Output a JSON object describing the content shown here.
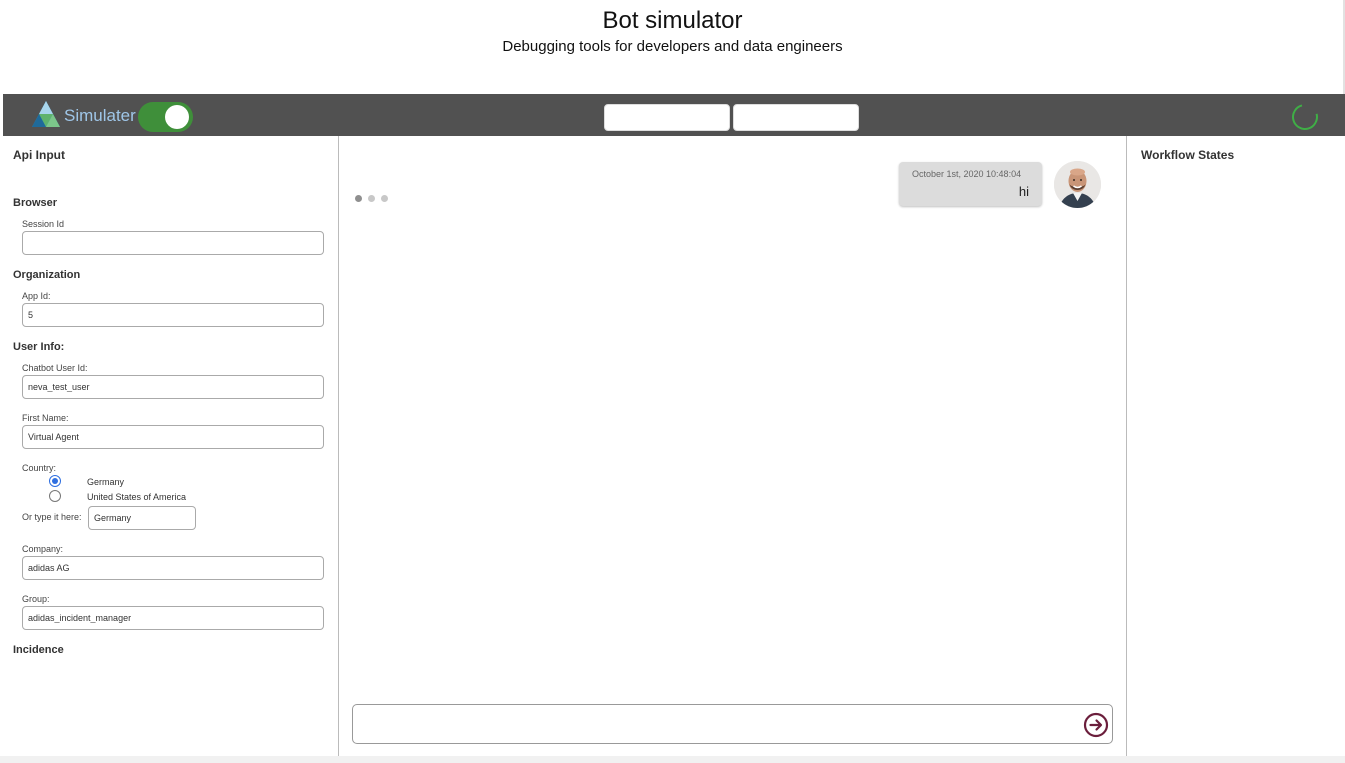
{
  "header": {
    "title": "Bot simulator",
    "subtitle": "Debugging tools for developers and data engineers"
  },
  "toolbar": {
    "brand": "Simulater",
    "toggle_on": true,
    "accent_color": "#3f8f3a",
    "spinner_color": "#3fae46"
  },
  "left": {
    "title": "Api Input",
    "browser": {
      "heading": "Browser",
      "session_label": "Session Id",
      "session_value": ""
    },
    "organization": {
      "heading": "Organization",
      "app_label": "App Id:",
      "app_value": "5"
    },
    "user_info": {
      "heading": "User Info:",
      "chatbot_label": "Chatbot User Id:",
      "chatbot_value": "neva_test_user",
      "first_name_label": "First Name:",
      "first_name_value": "Virtual Agent",
      "country_label": "Country:",
      "country_options": [
        "Germany",
        "United States of America"
      ],
      "country_selected": "Germany",
      "type_label": "Or type it here:",
      "type_value": "Germany",
      "company_label": "Company:",
      "company_value": "adidas AG",
      "group_label": "Group:",
      "group_value": "adidas_incident_manager"
    },
    "incidence": {
      "heading": "Incidence"
    }
  },
  "chat": {
    "message": {
      "timestamp": "October 1st, 2020 10:48:04",
      "text": "hi"
    },
    "input_value": ""
  },
  "right": {
    "title": "Workflow States"
  }
}
